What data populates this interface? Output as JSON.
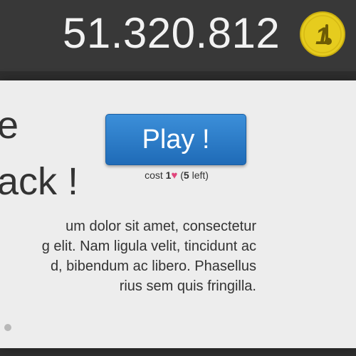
{
  "header": {
    "score": "51.320.812",
    "coin_label": "1",
    "coin_color": "#e6cc1e"
  },
  "main": {
    "title_line_1": "e",
    "title_line_2": "ack !",
    "body_lines": [
      "um dolor sit amet, consectetur",
      "g elit. Nam ligula velit, tincidunt ac",
      "d, bibendum ac libero. Phasellus",
      "rius sem quis fringilla."
    ]
  },
  "play": {
    "label": "Play !",
    "cost_prefix": "cost ",
    "cost_amount": "1",
    "cost_icon": "heart-icon",
    "left_open": " (",
    "left_count": "5",
    "left_suffix": " left)"
  },
  "colors": {
    "accent": "#2a7cca",
    "heart": "#e0457b"
  }
}
